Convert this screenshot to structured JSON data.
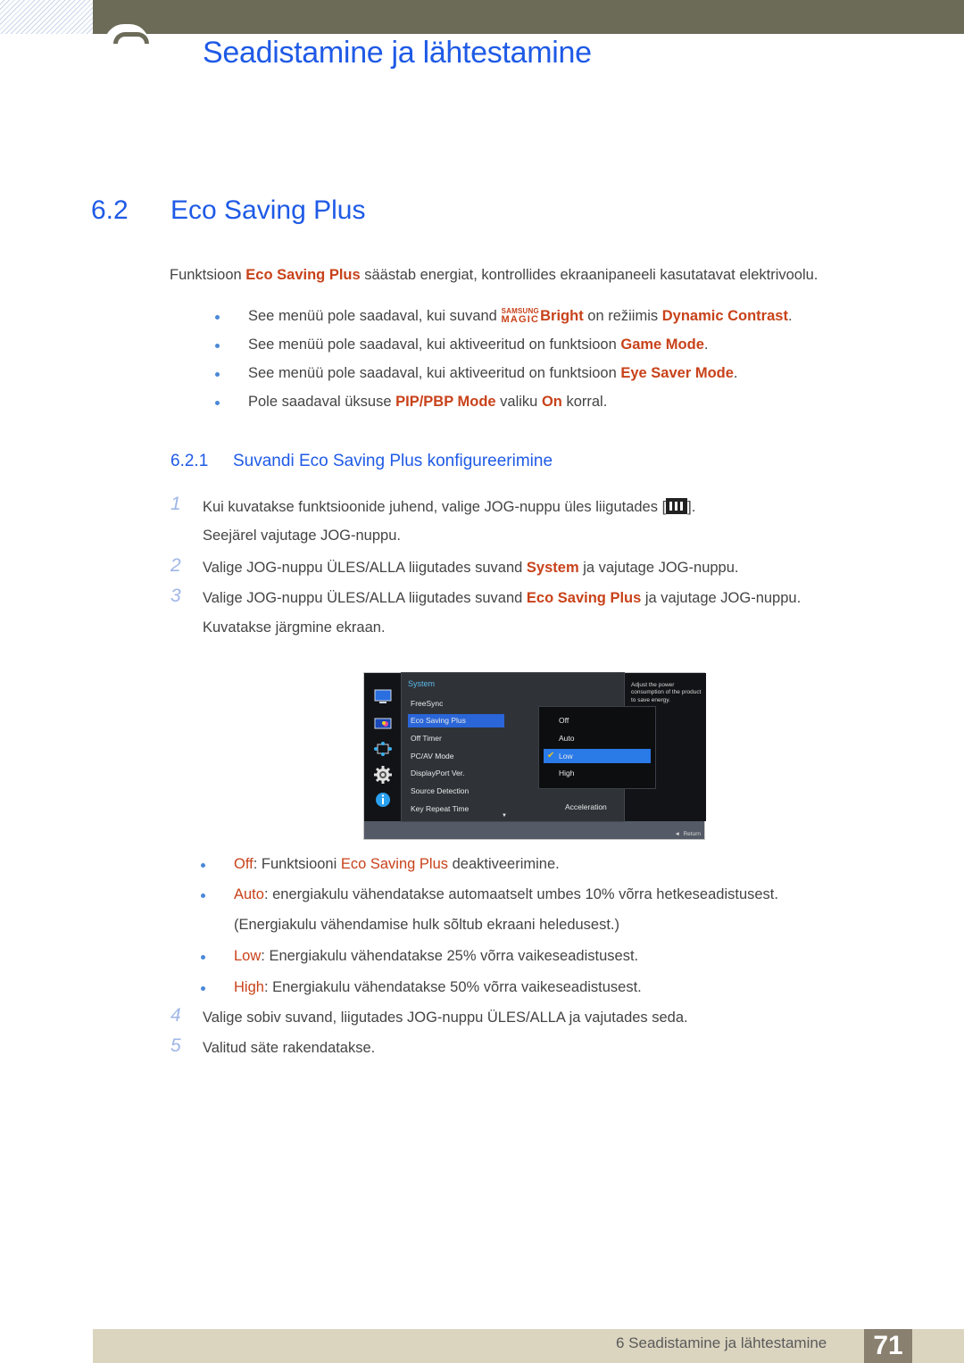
{
  "header": {
    "chapter_title": "Seadistamine ja lähtestamine"
  },
  "section": {
    "number": "6.2",
    "title": "Eco Saving Plus"
  },
  "intro": {
    "pre": "Funktsioon ",
    "highlight": "Eco Saving Plus",
    "post": " säästab energiat, kontrollides ekraanipaneeli kasutatavat elektrivoolu."
  },
  "notes": [
    {
      "pre": "See menüü pole saadaval, kui suvand ",
      "magic_top": "SAMSUNG",
      "magic_bottom": "MAGIC",
      "h1": "Bright",
      "mid": " on režiimis ",
      "h2": "Dynamic Contrast",
      "post": "."
    },
    {
      "pre": "See menüü pole saadaval, kui aktiveeritud on funktsioon ",
      "h1": "Game Mode",
      "post": "."
    },
    {
      "pre": "See menüü pole saadaval, kui aktiveeritud on funktsioon ",
      "h1": "Eye Saver Mode",
      "post": "."
    },
    {
      "pre": "Pole saadaval üksuse ",
      "h1": "PIP/PBP Mode",
      "mid": " valiku ",
      "h2": "On",
      "post": " korral."
    }
  ],
  "subsection": {
    "number": "6.2.1",
    "title": "Suvandi Eco Saving Plus konfigureerimine"
  },
  "steps": [
    {
      "num": "1",
      "line1_pre": "Kui kuvatakse funktsioonide juhend, valige JOG-nuppu üles liigutades [",
      "line1_post": "].",
      "line2": "Seejärel vajutage JOG-nuppu."
    },
    {
      "num": "2",
      "pre": "Valige JOG-nuppu ÜLES/ALLA liigutades suvand ",
      "h1": "System",
      "post": " ja vajutage JOG-nuppu."
    },
    {
      "num": "3",
      "pre": "Valige JOG-nuppu ÜLES/ALLA liigutades suvand ",
      "h1": "Eco Saving Plus",
      "post": " ja vajutage JOG-nuppu.",
      "line2": "Kuvatakse järgmine ekraan."
    },
    {
      "num": "4",
      "text": "Valige sobiv suvand, liigutades JOG-nuppu ÜLES/ALLA ja vajutades seda."
    },
    {
      "num": "5",
      "text": "Valitud säte rakendatakse."
    }
  ],
  "osd": {
    "category": "System",
    "items": [
      "FreeSync",
      "Eco Saving Plus",
      "Off Timer",
      "PC/AV Mode",
      "DisplayPort Ver.",
      "Source Detection",
      "Key Repeat Time"
    ],
    "selected_item": "Eco Saving Plus",
    "key_repeat_value": "Acceleration",
    "options": [
      "Off",
      "Auto",
      "Low",
      "High"
    ],
    "selected_option": "Low",
    "description": "Adjust the power consumption of the product to save energy.",
    "return_label": "Return",
    "icons": [
      "picture-icon",
      "color-icon",
      "size-position-icon",
      "system-gear-icon",
      "info-icon"
    ]
  },
  "options_explained": [
    {
      "label": "Off",
      "pre": ": Funktsiooni ",
      "h2": "Eco Saving Plus",
      "post": " deaktiveerimine."
    },
    {
      "label": "Auto",
      "pre": ": energiakulu vähendatakse automaatselt umbes 10% võrra hetkeseadistusest.",
      "line2": "(Energiakulu vähendamise hulk sõltub ekraani heledusest.)"
    },
    {
      "label": "Low",
      "pre": ": Energiakulu vähendatakse 25% võrra vaikeseadistusest."
    },
    {
      "label": "High",
      "pre": ": Energiakulu vähendatakse 50% võrra vaikeseadistusest."
    }
  ],
  "footer": {
    "chapter": "6 Seadistamine ja lähtestamine",
    "page": "71"
  },
  "colors": {
    "heading_blue": "#1e5ae6",
    "highlight_orange": "#c8421a",
    "topbar": "#6c6b58",
    "footer": "#dbd5c0",
    "page_box": "#8a8070"
  }
}
